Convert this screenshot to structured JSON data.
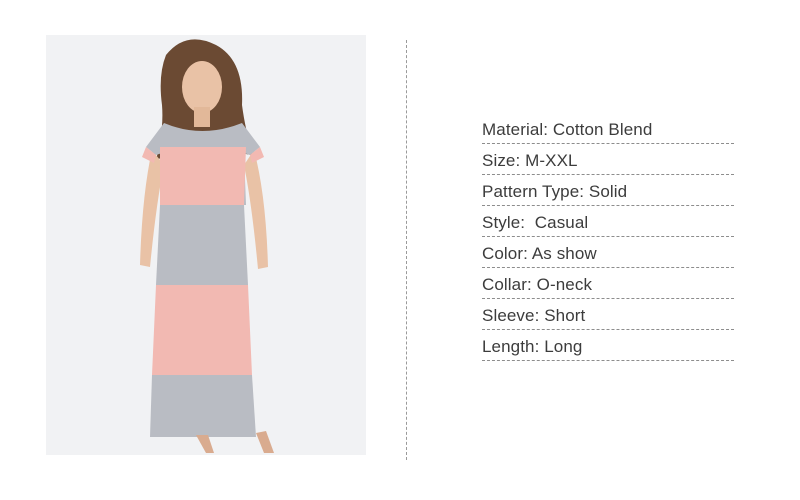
{
  "specs": [
    "Material: Cotton Blend",
    "Size: M-XXL",
    "Pattern Type: Solid",
    "Style:  Casual",
    "Color: As show",
    "Collar: O-neck",
    "Sleeve: Short",
    "Length: Long"
  ],
  "colors": {
    "grey_panel": "#b9bcc3",
    "pink_panel": "#f2b9b2",
    "hair": "#6b4a33",
    "skin": "#e9c2a6"
  }
}
